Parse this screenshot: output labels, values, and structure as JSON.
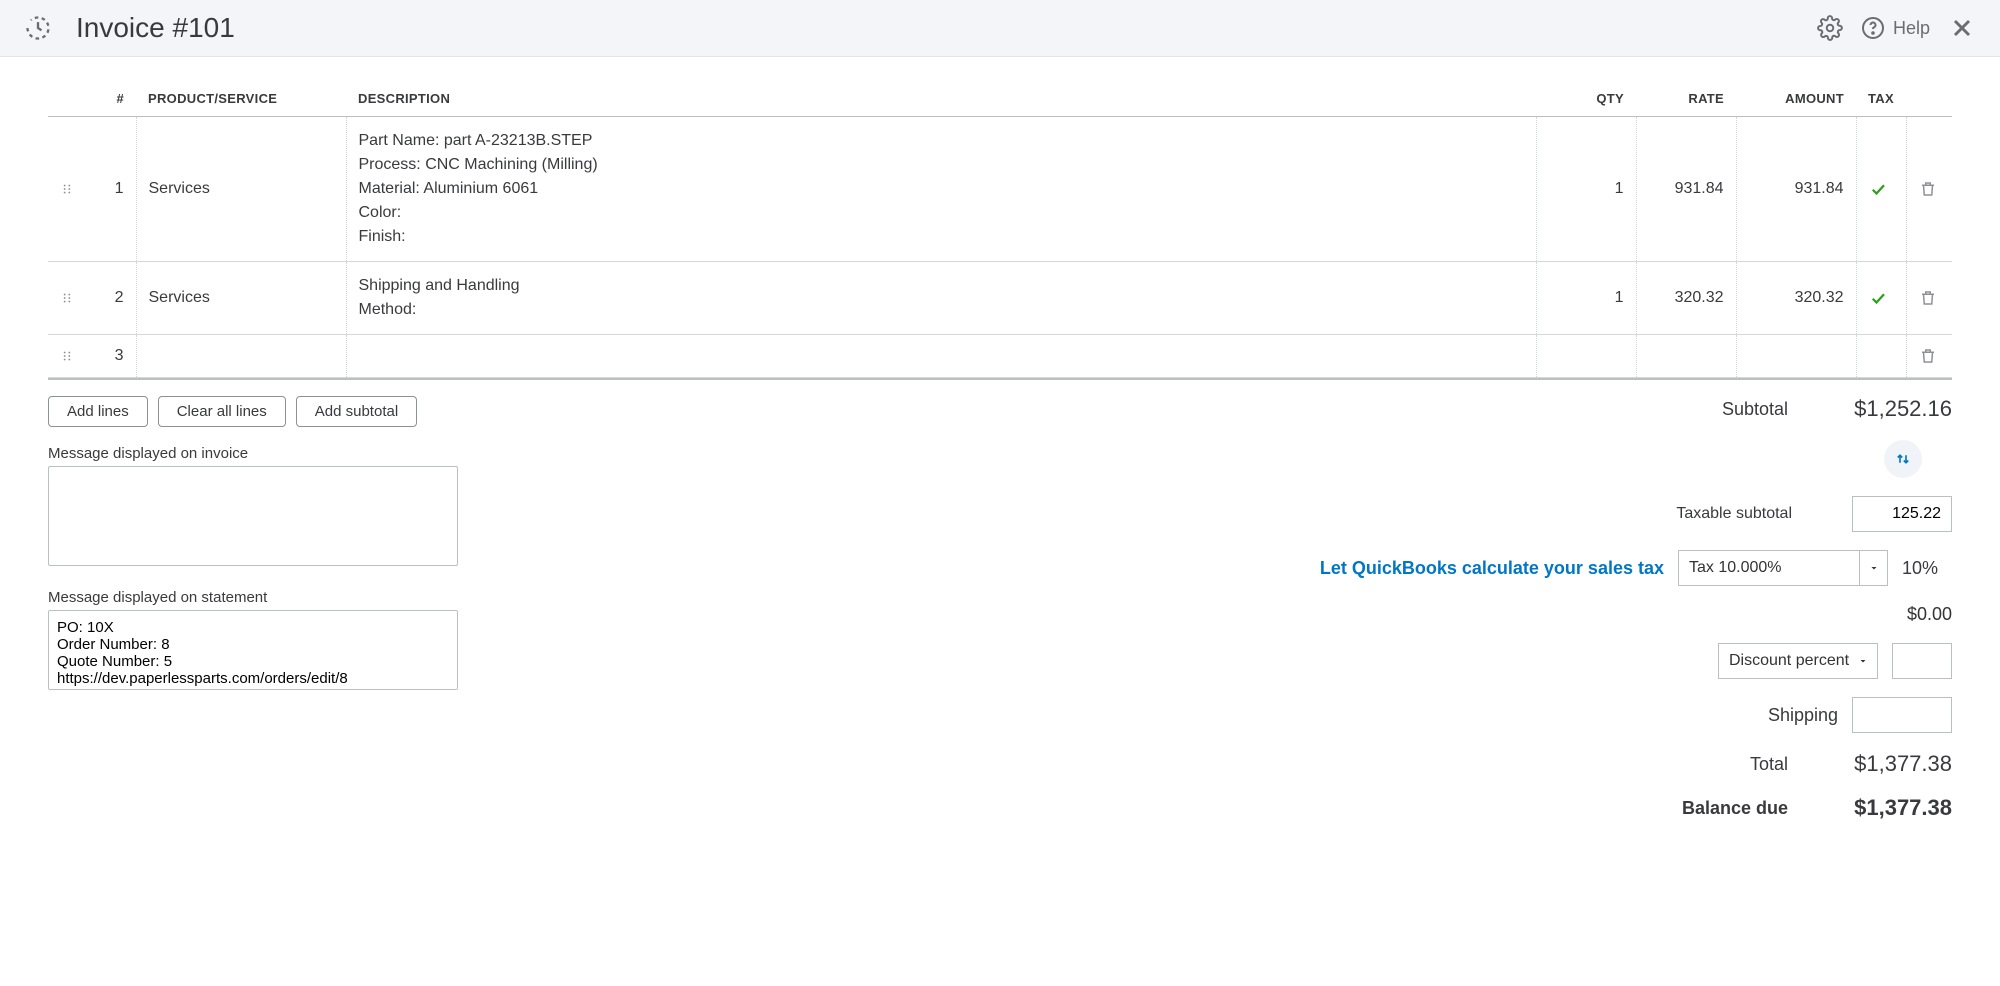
{
  "header": {
    "title": "Invoice #101",
    "help_label": "Help"
  },
  "table": {
    "headers": {
      "num": "#",
      "product": "PRODUCT/SERVICE",
      "description": "DESCRIPTION",
      "qty": "QTY",
      "rate": "RATE",
      "amount": "AMOUNT",
      "tax": "TAX"
    },
    "rows": [
      {
        "num": "1",
        "product": "Services",
        "description": "Part Name: part A-23213B.STEP\nProcess: CNC Machining (Milling)\nMaterial: Aluminium 6061\nColor:\nFinish:",
        "qty": "1",
        "rate": "931.84",
        "amount": "931.84",
        "tax": true
      },
      {
        "num": "2",
        "product": "Services",
        "description": "Shipping and Handling\nMethod:",
        "qty": "1",
        "rate": "320.32",
        "amount": "320.32",
        "tax": true
      },
      {
        "num": "3",
        "product": "",
        "description": "",
        "qty": "",
        "rate": "",
        "amount": "",
        "tax": false
      }
    ]
  },
  "buttons": {
    "add_lines": "Add lines",
    "clear_all": "Clear all lines",
    "add_subtotal": "Add subtotal"
  },
  "messages": {
    "invoice_label": "Message displayed on invoice",
    "invoice_value": "",
    "statement_label": "Message displayed on statement",
    "statement_value": "PO: 10X\nOrder Number: 8\nQuote Number: 5\nhttps://dev.paperlessparts.com/orders/edit/8"
  },
  "totals": {
    "subtotal_label": "Subtotal",
    "subtotal_value": "$1,252.16",
    "taxable_subtotal_label": "Taxable subtotal",
    "taxable_subtotal_value": "125.22",
    "tax_link": "Let QuickBooks calculate your sales tax",
    "tax_select": "Tax 10.000%",
    "tax_pct": "10%",
    "zero_value": "$0.00",
    "discount_select": "Discount percent",
    "discount_value": "",
    "shipping_label": "Shipping",
    "shipping_value": "",
    "total_label": "Total",
    "total_value": "$1,377.38",
    "balance_label": "Balance due",
    "balance_value": "$1,377.38"
  }
}
